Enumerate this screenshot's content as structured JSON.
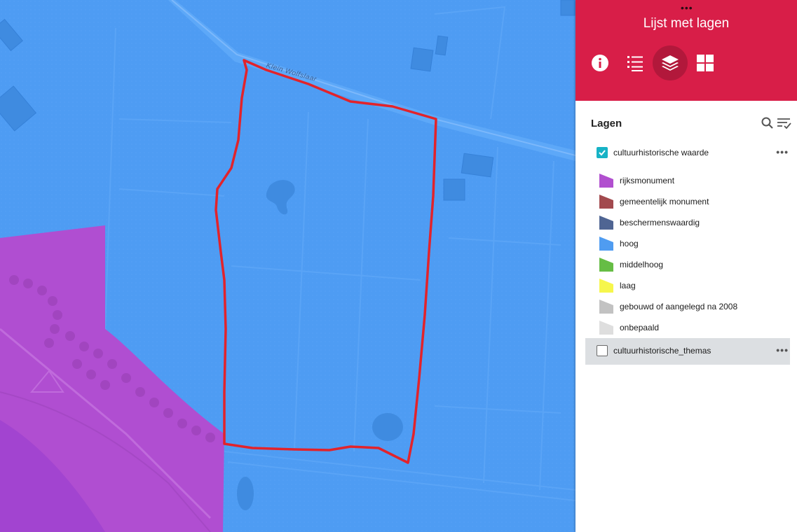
{
  "map": {
    "street_label": "Klein Wolfslaar",
    "colors": {
      "hoog_fill": "#4e9cf3",
      "rijksmonument_fill": "#b04ed1",
      "boundary": "#e2232b"
    }
  },
  "panel": {
    "title": "Lijst met lagen",
    "drag_handle": "•••",
    "tools": [
      {
        "name": "info",
        "icon": "info-icon",
        "active": false
      },
      {
        "name": "legend",
        "icon": "list-icon",
        "active": false
      },
      {
        "name": "layers",
        "icon": "layers-icon",
        "active": true
      },
      {
        "name": "basemap",
        "icon": "grid-icon",
        "active": false
      }
    ],
    "accent_color": "#d81e48"
  },
  "layers": {
    "heading": "Lagen",
    "search_icon": "search-icon",
    "filter_icon": "filter-icon",
    "items": [
      {
        "label": "cultuurhistorische waarde",
        "checked": true,
        "expanded": true,
        "more": "•••",
        "legend": [
          {
            "label": "rijksmonument",
            "color": "#b14fcf"
          },
          {
            "label": "gemeentelijk monument",
            "color": "#a24a4e"
          },
          {
            "label": "beschermenswaardig",
            "color": "#4f6593"
          },
          {
            "label": "hoog",
            "color": "#4f9cf1"
          },
          {
            "label": "middelhoog",
            "color": "#66bd45"
          },
          {
            "label": "laag",
            "color": "#f6f64c"
          },
          {
            "label": "gebouwd of aangelegd na 2008",
            "color": "#c2c2c2"
          },
          {
            "label": "onbepaald",
            "color": "#dedede"
          }
        ]
      },
      {
        "label": "cultuurhistorische_themas",
        "checked": false,
        "expanded": false,
        "more": "•••"
      }
    ]
  }
}
